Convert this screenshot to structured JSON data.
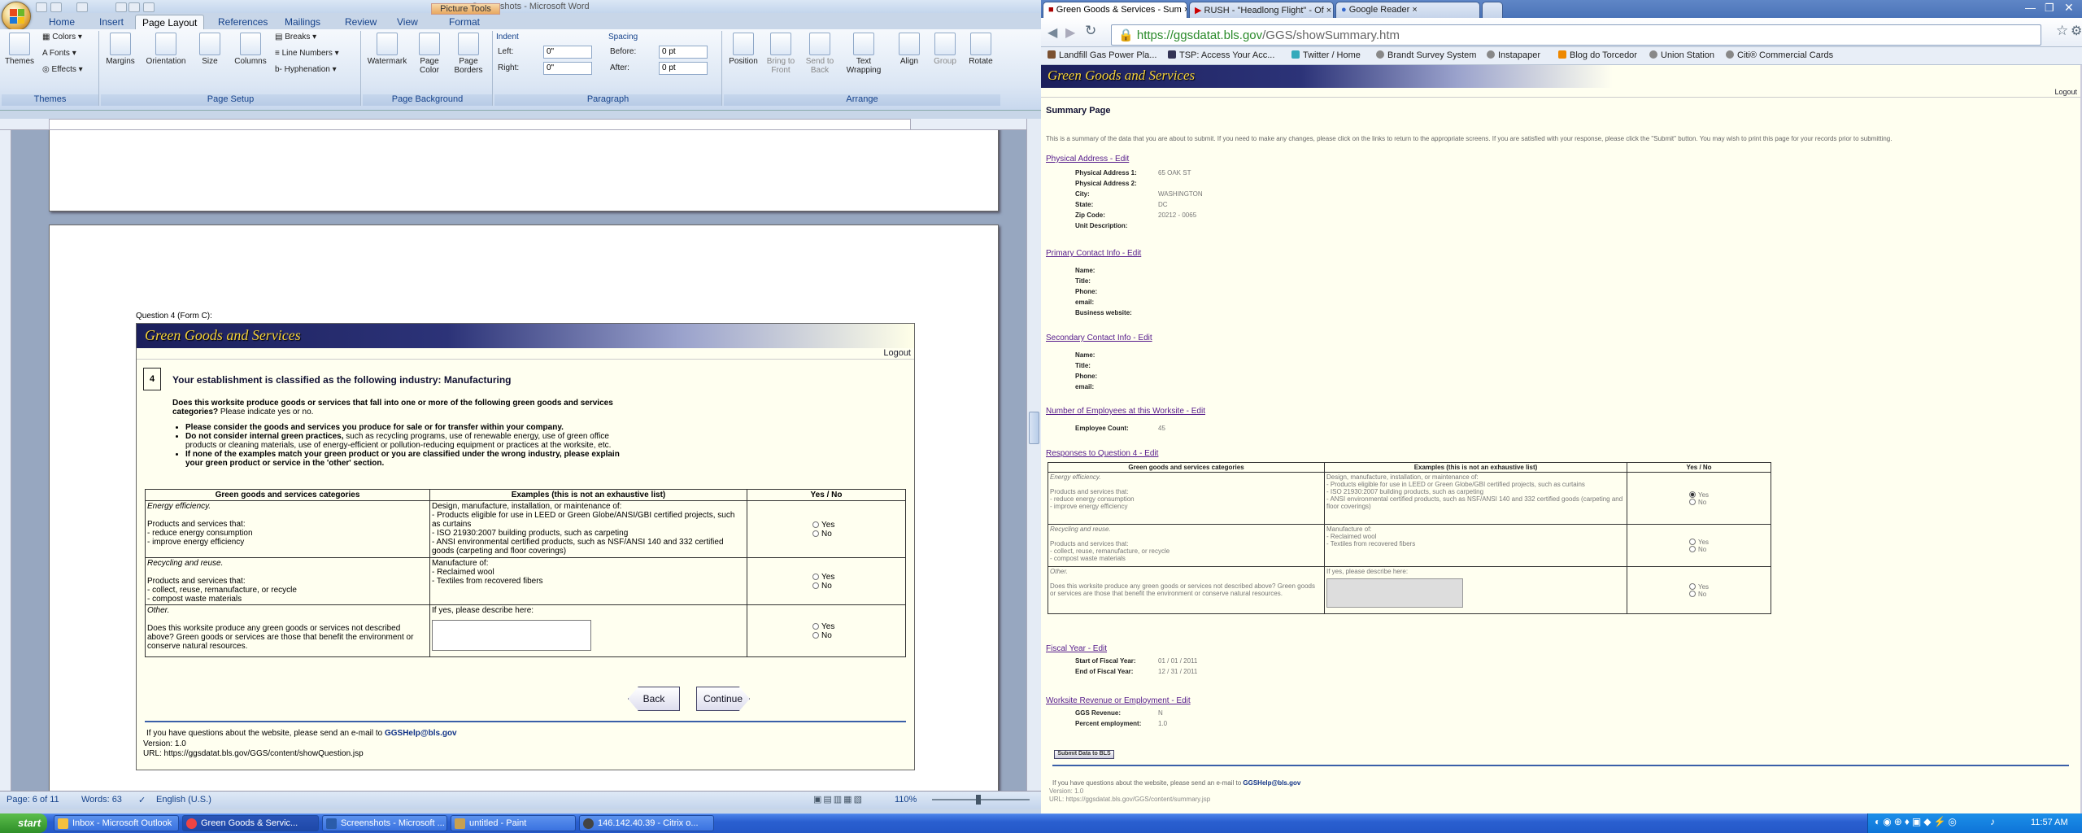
{
  "word": {
    "title": "Screenshots - Microsoft Word",
    "picture_tools": "Picture Tools",
    "tabs": [
      "Home",
      "Insert",
      "Page Layout",
      "References",
      "Mailings",
      "Review",
      "View",
      "Format"
    ],
    "groups": {
      "themes": {
        "label": "Themes",
        "themes_btn": "Themes",
        "colors": "Colors",
        "fonts": "Fonts",
        "effects": "Effects"
      },
      "page_setup": {
        "label": "Page Setup",
        "margins": "Margins",
        "orientation": "Orientation",
        "size": "Size",
        "columns": "Columns",
        "breaks": "Breaks",
        "line_numbers": "Line Numbers",
        "hyphenation": "Hyphenation"
      },
      "page_background": {
        "label": "Page Background",
        "watermark": "Watermark",
        "page_color": "Page Color",
        "page_borders": "Page Borders"
      },
      "paragraph": {
        "label": "Paragraph",
        "indent": "Indent",
        "spacing": "Spacing",
        "left_label": "Left:",
        "right_label": "Right:",
        "before_label": "Before:",
        "after_label": "After:",
        "left": "0\"",
        "right": "0\"",
        "before": "0 pt",
        "after": "0 pt"
      },
      "arrange": {
        "label": "Arrange",
        "position": "Position",
        "bring_to_front": "Bring to Front",
        "send_to_back": "Send to Back",
        "text_wrapping": "Text Wrapping",
        "align": "Align",
        "group": "Group",
        "rotate": "Rotate"
      }
    },
    "doc": {
      "caption": "Question 4 (Form C):",
      "banner": "Green Goods and Services",
      "logout": "Logout",
      "qnum": "4",
      "heading": "Your establishment is classified as the following industry: Manufacturing",
      "question_bold": "Does this worksite produce goods or services that fall into one or more of the following green goods and services categories?",
      "question_rest": "Please indicate yes or no.",
      "bullets": [
        {
          "bold": "Please consider the goods and services you produce for sale or for transfer within your company.",
          "rest": ""
        },
        {
          "bold": "Do not consider internal green practices,",
          "rest": " such as recycling programs, use of renewable energy, use of green office products or cleaning materials, use of energy-efficient or pollution-reducing equipment or practices at the worksite, etc."
        },
        {
          "bold": "If none of the examples match your green product or you are classified under the wrong industry, please explain your green product or service in the 'other' section.",
          "rest": ""
        }
      ],
      "table": {
        "headers": [
          "Green goods and services categories",
          "Examples (this is not an exhaustive list)",
          "Yes / No"
        ],
        "rows": [
          {
            "cat": "Energy efficiency.",
            "desc": "Products and services that:\n- reduce energy consumption\n- improve energy efficiency",
            "ex": "Design, manufacture, installation, or maintenance of:\n- Products eligible for use in LEED or Green Globe/ANSI/GBI certified projects, such as curtains\n- ISO 21930:2007 building products, such as carpeting\n- ANSI environmental certified products, such as NSF/ANSI 140 and 332 certified goods (carpeting and floor coverings)"
          },
          {
            "cat": "Recycling and reuse.",
            "desc": "Products and services that:\n- collect, reuse, remanufacture, or recycle\n- compost waste materials",
            "ex": "Manufacture of:\n- Reclaimed wool\n- Textiles from recovered fibers"
          },
          {
            "cat": "Other.",
            "desc": "Does this worksite produce any green goods or services not described above? Green goods or services are those that benefit the environment or conserve natural resources.",
            "ex": "If yes, please describe here:"
          }
        ],
        "yes": "Yes",
        "no": "No"
      },
      "back": "Back",
      "continue": "Continue",
      "footer_text": "If you have questions about the website, please send an e-mail to",
      "footer_email": "GGSHelp@bls.gov",
      "version": "Version: 1.0",
      "url": "URL: https://ggsdatat.bls.gov/GGS/content/showQuestion.jsp"
    },
    "status": {
      "page": "Page: 6 of 11",
      "words": "Words: 63",
      "language": "English (U.S.)",
      "zoom": "110%"
    }
  },
  "browser": {
    "tabs": [
      "Green Goods & Services - Sum",
      "RUSH - \"Headlong Flight\" - Of",
      "Google Reader"
    ],
    "url_host": "https://ggsdatat.bls.gov",
    "url_path": "/GGS/showSummary.htm",
    "bookmarks": [
      "Landfill Gas Power Pla...",
      "TSP: Access Your Acc...",
      "Twitter / Home",
      "Brandt Survey System",
      "Instapaper",
      "Blog do Torcedor",
      "Union Station",
      "Citi® Commercial Cards"
    ],
    "page": {
      "banner": "Green Goods and Services",
      "logout": "Logout",
      "title": "Summary Page",
      "intro": "This is a summary of the data that you are about to submit. If you need to make any changes, please click on the links to return to the appropriate screens. If you are satisfied with your response, please click the \"Submit\" button. You may wish to print this page for your records prior to submitting.",
      "physical": {
        "title": "Physical Address - Edit",
        "fields": [
          [
            "Physical Address 1:",
            "65 OAK ST"
          ],
          [
            "Physical Address 2:",
            ""
          ],
          [
            "City:",
            "WASHINGTON"
          ],
          [
            "State:",
            "DC"
          ],
          [
            "Zip Code:",
            "20212 - 0065"
          ],
          [
            "Unit Description:",
            ""
          ]
        ]
      },
      "primary": {
        "title": "Primary Contact Info - Edit",
        "fields": [
          [
            "Name:",
            ""
          ],
          [
            "Title:",
            ""
          ],
          [
            "Phone:",
            ""
          ],
          [
            "email:",
            ""
          ],
          [
            "Business website:",
            ""
          ]
        ]
      },
      "secondary": {
        "title": "Secondary Contact Info - Edit",
        "fields": [
          [
            "Name:",
            ""
          ],
          [
            "Title:",
            ""
          ],
          [
            "Phone:",
            ""
          ],
          [
            "email:",
            ""
          ]
        ]
      },
      "employees": {
        "title": "Number of Employees at this Worksite - Edit",
        "fields": [
          [
            "Employee Count:",
            "45"
          ]
        ]
      },
      "q4": {
        "title": "Responses to Question 4 - Edit",
        "headers": [
          "Green goods and services categories",
          "Examples (this is not an exhaustive list)",
          "Yes / No"
        ],
        "rows": [
          {
            "cat": "Energy efficiency.",
            "desc": "Products and services that:\n- reduce energy consumption\n- improve energy efficiency",
            "ex": "Design, manufacture, installation, or maintenance of:\n- Products eligible for use in LEED or Green Globe/GBI certified projects, such as curtains\n- ISO 21930:2007 building products, such as carpeting\n- ANSI environmental certified products, such as NSF/ANSI 140 and 332 certified goods (carpeting and floor coverings)",
            "selected": "yes"
          },
          {
            "cat": "Recycling and reuse.",
            "desc": "Products and services that:\n- collect, reuse, remanufacture, or recycle\n- compost waste materials",
            "ex": "Manufacture of:\n- Reclaimed wool\n- Textiles from recovered fibers",
            "selected": "none"
          },
          {
            "cat": "Other.",
            "desc": "Does this worksite produce any green goods or services not described above? Green goods or services are those that benefit the environment or conserve natural resources.",
            "ex": "If yes, please describe here:",
            "selected": "none"
          }
        ],
        "yes": "Yes",
        "no": "No"
      },
      "fiscal": {
        "title": "Fiscal Year - Edit",
        "fields": [
          [
            "Start of Fiscal Year:",
            "01 / 01 / 2011"
          ],
          [
            "End of Fiscal Year:",
            "12 / 31 / 2011"
          ]
        ]
      },
      "revenue": {
        "title": "Worksite Revenue or Employment - Edit",
        "fields": [
          [
            "GGS Revenue:",
            "N"
          ],
          [
            "Percent employment:",
            "1.0"
          ]
        ]
      },
      "submit": "Submit Data to BLS",
      "footer_text": "If you have questions about the website, please send an e-mail to",
      "footer_email": "GGSHelp@bls.gov",
      "version": "Version: 1.0",
      "url": "URL: https://ggsdatat.bls.gov/GGS/content/summary.jsp"
    }
  },
  "taskbar": {
    "start": "start",
    "tasks": [
      "Inbox - Microsoft Outlook",
      "Green Goods & Servic...",
      "Screenshots - Microsoft ...",
      "untitled - Paint",
      "146.142.40.39 - Citrix o..."
    ],
    "clock": "11:57 AM"
  }
}
